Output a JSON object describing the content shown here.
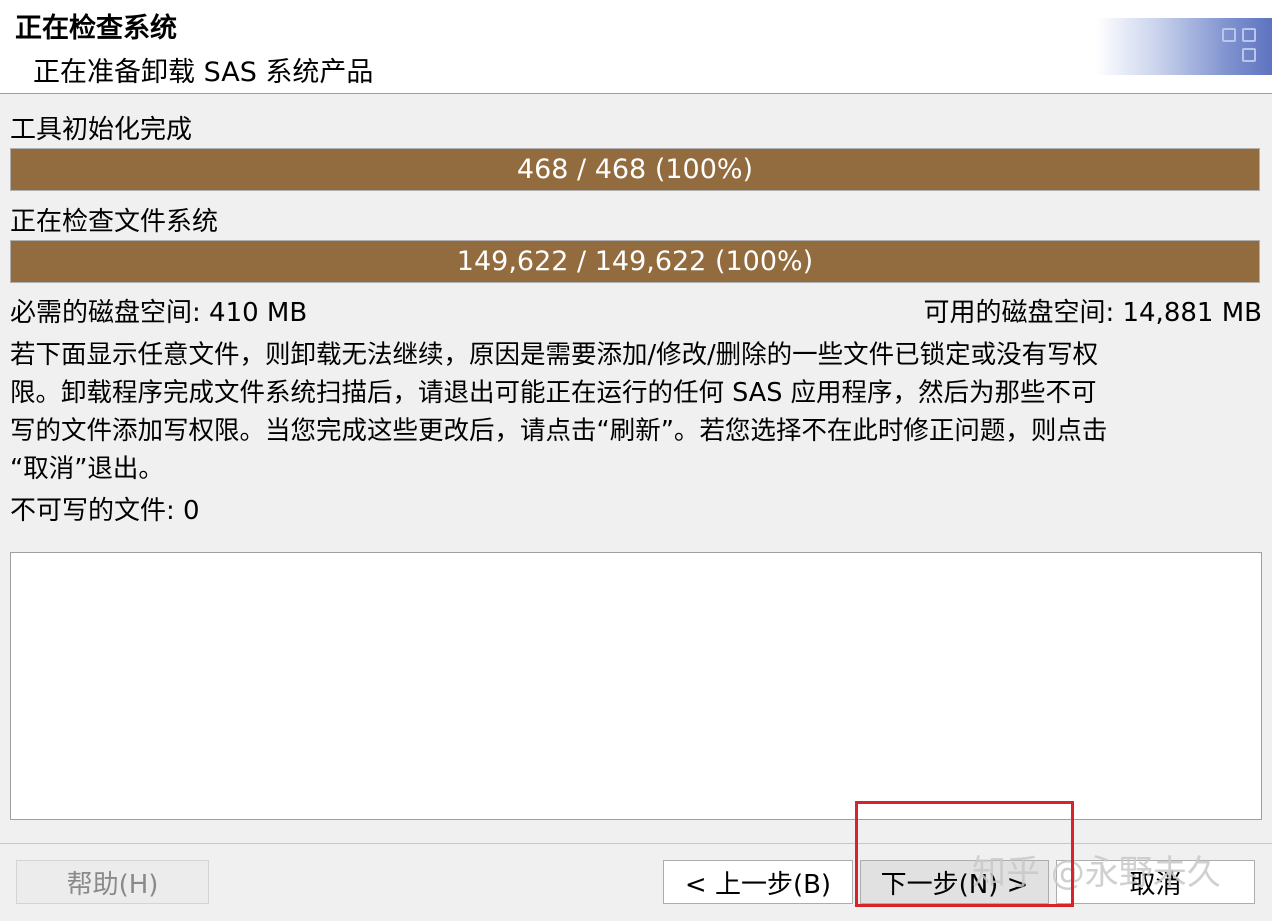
{
  "header": {
    "title": "正在检查系统",
    "subtitle": "正在准备卸载 SAS 系统产品"
  },
  "tool_init": {
    "label": "工具初始化完成",
    "progress_text": "468 / 468 (100%)",
    "progress_fraction": 1.0
  },
  "file_check": {
    "label": "正在检查文件系统",
    "progress_text": "149,622 / 149,622 (100%)",
    "progress_fraction": 1.0
  },
  "disk": {
    "required": "必需的磁盘空间: 410 MB",
    "available": "可用的磁盘空间: 14,881 MB"
  },
  "description": {
    "line1": "若下面显示任意文件，则卸载无法继续，原因是需要添加/修改/删除的一些文件已锁定或没有写权",
    "line2": "限。卸载程序完成文件系统扫描后，请退出可能正在运行的任何 SAS 应用程序，然后为那些不可",
    "line3": "写的文件添加写权限。当您完成这些更改后，请点击“刷新”。若您选择不在此时修正问题，则点击",
    "line4": "“取消”退出。"
  },
  "unwritable": {
    "label": "不可写的文件: 0"
  },
  "buttons": {
    "help": "帮助(H)",
    "back": "< 上一步(B)",
    "next": "下一步(N) >",
    "cancel": "取消"
  },
  "watermark": "知乎 @永野未久",
  "colors": {
    "progress_fill": "#926b3e",
    "highlight": "#d9232a"
  }
}
